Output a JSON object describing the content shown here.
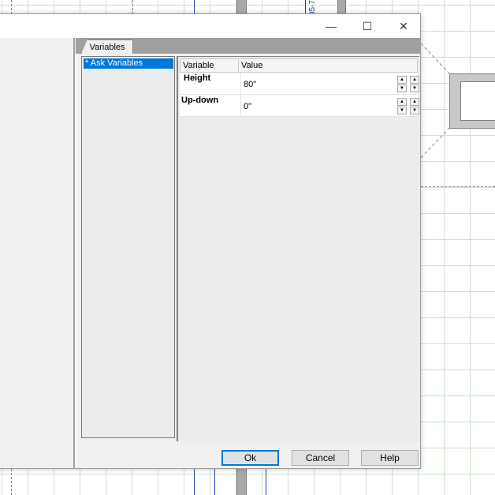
{
  "background": {
    "dimension_text": "95-7"
  },
  "window": {
    "controls": {
      "minimize_icon": "—",
      "maximize_icon": "☐",
      "close_icon": "✕"
    }
  },
  "tabs": [
    {
      "label": "Variables"
    }
  ],
  "categories": [
    {
      "label": "* Ask Variables",
      "selected": true
    }
  ],
  "grid": {
    "headers": {
      "variable": "Variable",
      "value": "Value"
    },
    "rows": [
      {
        "name": "Height",
        "value": "80\""
      },
      {
        "name": "Up-down",
        "value": "0\""
      }
    ]
  },
  "buttons": {
    "ok": "Ok",
    "cancel": "Cancel",
    "help": "Help"
  },
  "colors": {
    "selection": "#0078d7",
    "grid_lines": "#c9e3c9",
    "dimension_lines": "#2b3fa8"
  }
}
